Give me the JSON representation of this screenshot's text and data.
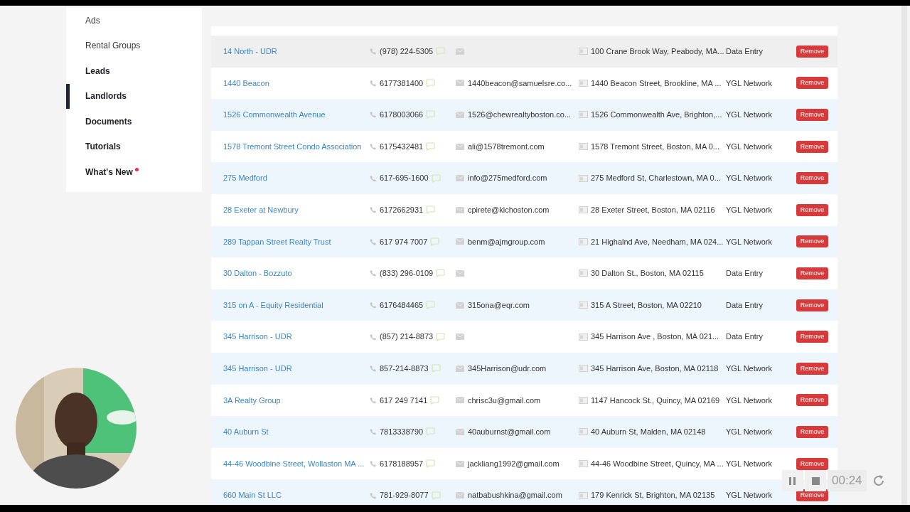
{
  "sidebar": {
    "items": [
      {
        "label": "Ads",
        "selected": false,
        "bold": false,
        "notification": false
      },
      {
        "label": "Rental Groups",
        "selected": false,
        "bold": false,
        "notification": false
      },
      {
        "label": "Leads",
        "selected": false,
        "bold": true,
        "notification": false
      },
      {
        "label": "Landlords",
        "selected": true,
        "bold": true,
        "notification": false
      },
      {
        "label": "Documents",
        "selected": false,
        "bold": true,
        "notification": false
      },
      {
        "label": "Tutorials",
        "selected": false,
        "bold": true,
        "notification": false
      },
      {
        "label": "What's New",
        "selected": false,
        "bold": true,
        "notification": true
      }
    ]
  },
  "table": {
    "rows": [
      {
        "name": "14 North - UDR",
        "phone": "(978) 224-5305",
        "address": "100 Crane Brook Way, Peabody, MA...",
        "source": "Data Entry",
        "action": "Remove",
        "highlighted": true
      },
      {
        "name": "1440 Beacon",
        "phone": "6177381400",
        "email": "1440beacon@samuelsre.co...",
        "address": "1440 Beacon Street, Brookline, MA ...",
        "source": "YGL Network",
        "action": "Remove",
        "highlighted": false
      },
      {
        "name": "1526 Commonwealth Avenue",
        "phone": "6178003066",
        "email": "1526@chewrealtyboston.co...",
        "address": "1526 Commonwealth Ave, Brighton,...",
        "source": "YGL Network",
        "action": "Remove",
        "highlighted": false
      },
      {
        "name": "1578 Tremont Street Condo Association",
        "phone": "6175432481",
        "email": "ali@1578tremont.com",
        "address": "1578 Tremont Street, Boston, MA 0...",
        "source": "YGL Network",
        "action": "Remove",
        "highlighted": false
      },
      {
        "name": "275 Medford",
        "phone": "617-695-1600",
        "email": "info@275medford.com",
        "address": "275 Medford St, Charlestown, MA 0...",
        "source": "YGL Network",
        "action": "Remove",
        "highlighted": false
      },
      {
        "name": "28 Exeter at Newbury",
        "phone": "6172662931",
        "email": "cpirete@kichoston.com",
        "address": "28 Exeter Street, Boston, MA 02116",
        "source": "YGL Network",
        "action": "Remove",
        "highlighted": false
      },
      {
        "name": "289 Tappan Street Realty Trust",
        "phone": "617 974 7007",
        "email": "benm@ajmgroup.com",
        "address": "21 Highalnd Ave, Needham, MA 024...",
        "source": "YGL Network",
        "action": "Remove",
        "highlighted": false
      },
      {
        "name": "30 Dalton - Bozzuto",
        "phone": "(833) 296-0109",
        "address": "30 Dalton St., Boston, MA 02115",
        "source": "Data Entry",
        "action": "Remove",
        "highlighted": false
      },
      {
        "name": "315 on A - Equity Residential",
        "phone": "6176484465",
        "email": "315ona@eqr.com",
        "address": "315 A Street, Boston, MA 02210",
        "source": "Data Entry",
        "action": "Remove",
        "highlighted": false
      },
      {
        "name": "345 Harrison - UDR",
        "phone": "(857) 214-8873",
        "address": "345 Harrison Ave , Boston, MA 021...",
        "source": "Data Entry",
        "action": "Remove",
        "highlighted": false
      },
      {
        "name": "345 Harrison - UDR",
        "phone": "857-214-8873",
        "email": "345Harrison@udr.com",
        "address": "345 Harrison Ave, Boston, MA 02118",
        "source": "YGL Network",
        "action": "Remove",
        "highlighted": false
      },
      {
        "name": "3A Realty Group",
        "phone": "617 249 7141",
        "email": "chrisc3u@gmail.com",
        "address": "1147 Hancock St., Quincy, MA 02169",
        "source": "YGL Network",
        "action": "Remove",
        "highlighted": false
      },
      {
        "name": "40 Auburn St",
        "phone": "7813338790",
        "email": "40auburnst@gmail.com",
        "address": "40 Auburn St, Malden, MA 02148",
        "source": "YGL Network",
        "action": "Remove",
        "highlighted": false
      },
      {
        "name": "44-46 Woodbine Street, Wollaston MA ...",
        "phone": "6178188957",
        "email": "jackliang1992@gmail.com",
        "address": "44-46 Woodbine Street, Quincy, MA ...",
        "source": "YGL Network",
        "action": "Remove",
        "highlighted": false
      },
      {
        "name": "660 Main St LLC",
        "phone": "781-929-8077",
        "email": "natbabushkina@gmail.com",
        "address": "179 Kenrick St, Brighton, MA 02135",
        "source": "YGL Network",
        "action": "Remove",
        "highlighted": false
      }
    ]
  },
  "recorder": {
    "timer": "00:24"
  }
}
